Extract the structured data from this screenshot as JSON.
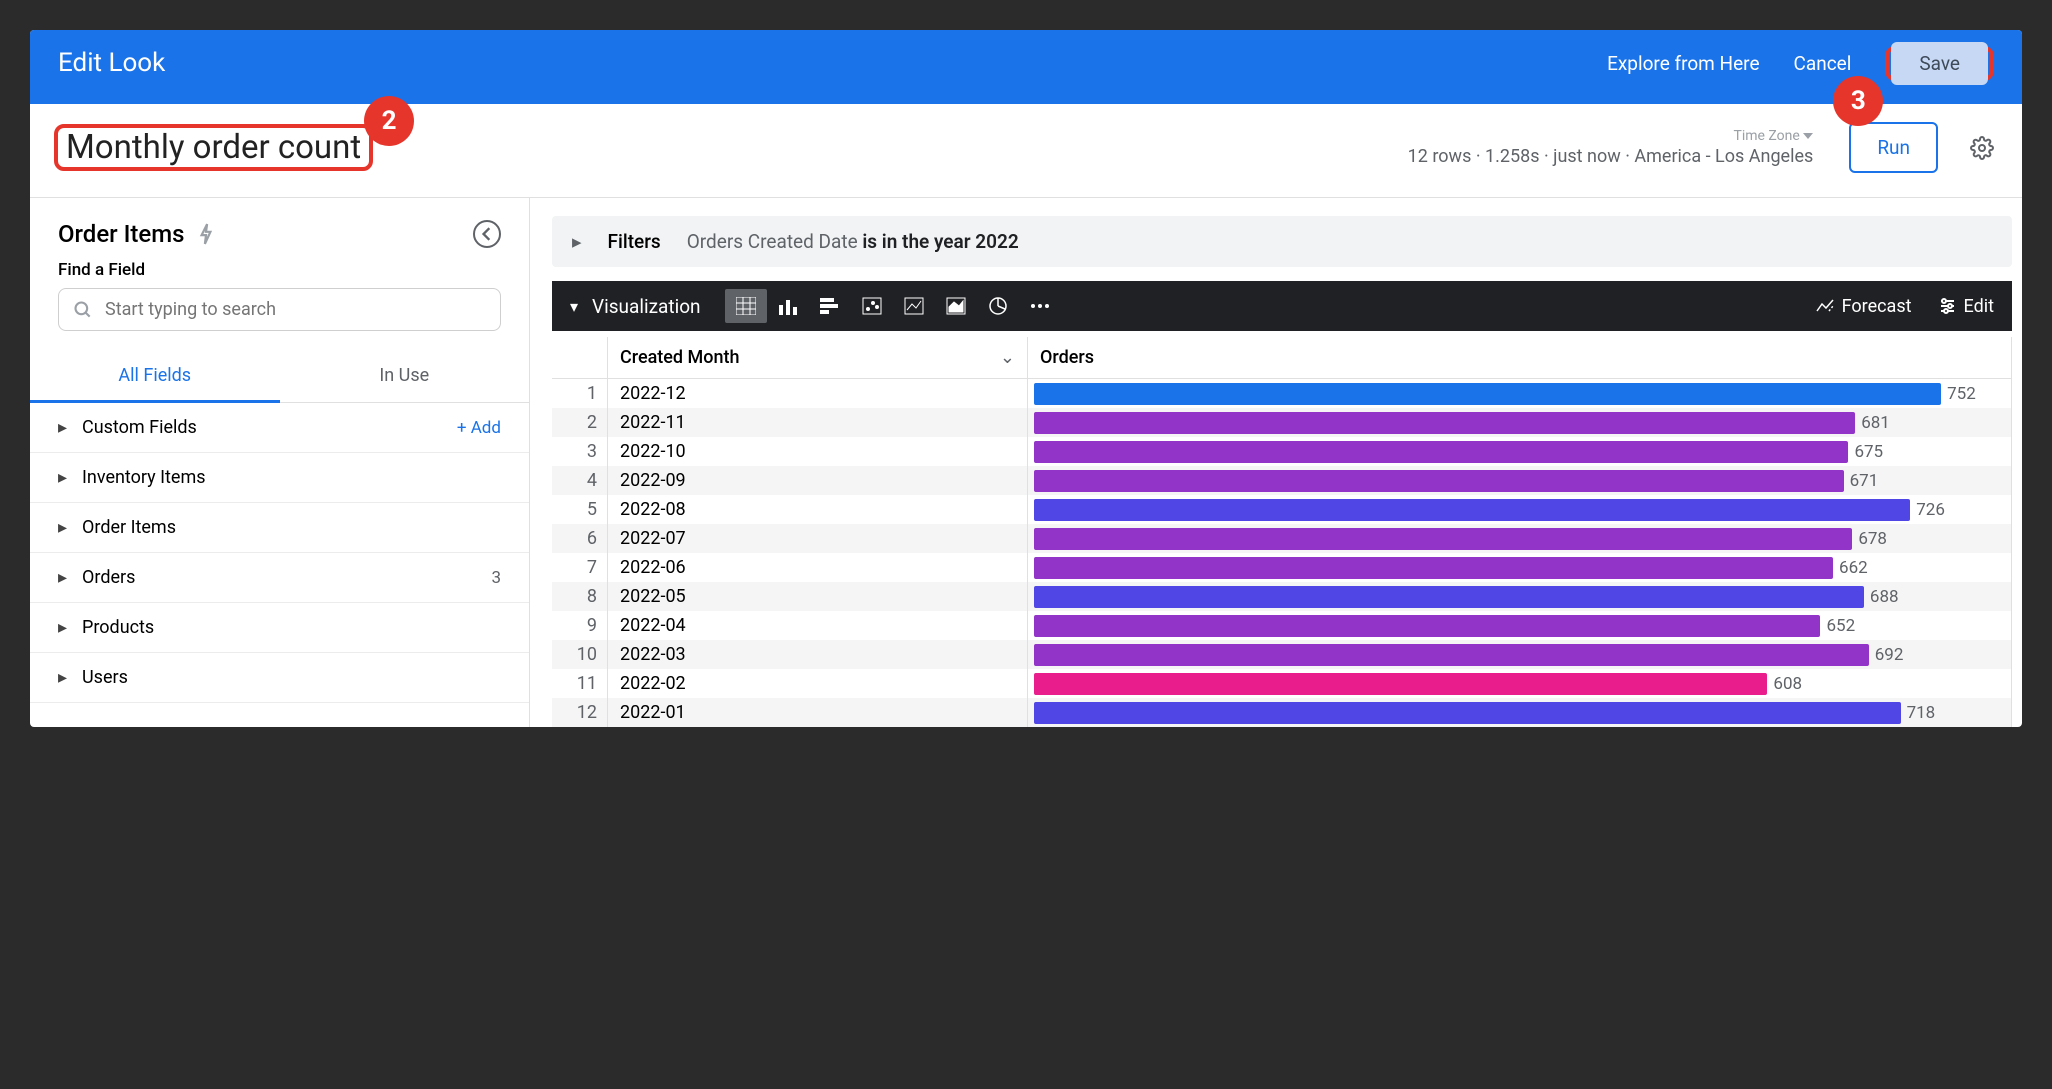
{
  "topbar": {
    "title": "Edit Look",
    "explore": "Explore from Here",
    "cancel": "Cancel",
    "save": "Save"
  },
  "callouts": {
    "two": "2",
    "three": "3"
  },
  "look": {
    "title": "Monthly order count",
    "timezone_label": "Time Zone",
    "status": "12 rows · 1.258s · just now · America - Los Angeles",
    "run": "Run"
  },
  "sidebar": {
    "title": "Order Items",
    "find_label": "Find a Field",
    "search_placeholder": "Start typing to search",
    "tabs": {
      "all": "All Fields",
      "inuse": "In Use"
    },
    "add": "Add",
    "folders": [
      {
        "name": "Custom Fields"
      },
      {
        "name": "Inventory Items"
      },
      {
        "name": "Order Items"
      },
      {
        "name": "Orders",
        "badge": "3"
      },
      {
        "name": "Products"
      },
      {
        "name": "Users"
      }
    ]
  },
  "filters": {
    "label": "Filters",
    "prefix": "Orders Created Date ",
    "bold": "is in the year 2022"
  },
  "viz": {
    "title": "Visualization",
    "forecast": "Forecast",
    "edit": "Edit"
  },
  "table": {
    "headers": {
      "month": "Created Month",
      "orders": "Orders"
    }
  },
  "chart_data": {
    "type": "bar",
    "title": "Monthly order count",
    "xlabel": "Created Month",
    "ylabel": "Orders",
    "series": [
      {
        "name": "Orders",
        "categories": [
          "2022-12",
          "2022-11",
          "2022-10",
          "2022-09",
          "2022-08",
          "2022-07",
          "2022-06",
          "2022-05",
          "2022-04",
          "2022-03",
          "2022-02",
          "2022-01"
        ],
        "values": [
          752,
          681,
          675,
          671,
          726,
          678,
          662,
          688,
          652,
          692,
          608,
          718
        ],
        "colors": [
          "#1a73e8",
          "#9334c9",
          "#9334c9",
          "#9334c9",
          "#4f46e5",
          "#9334c9",
          "#9334c9",
          "#4f46e5",
          "#9334c9",
          "#9334c9",
          "#e91e8c",
          "#4f46e5"
        ]
      }
    ],
    "xlim": [
      0,
      800
    ]
  }
}
